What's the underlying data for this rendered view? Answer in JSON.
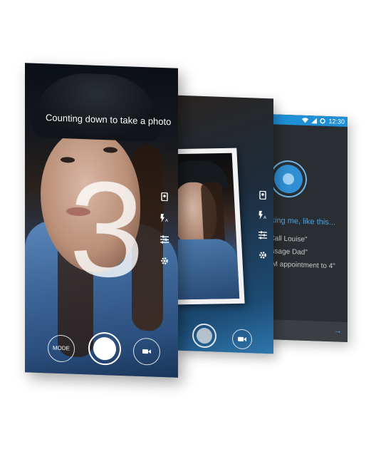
{
  "camera": {
    "prompt": "Counting down to take a photo",
    "countdown": "3",
    "mode_label": "MODE",
    "icons": [
      "portrait-icon",
      "flash-auto-icon",
      "filter-sliders-icon",
      "settings-gear-icon",
      "video-camera-icon"
    ]
  },
  "preview": {
    "icons": [
      "portrait-icon",
      "flash-auto-icon",
      "filter-sliders-icon",
      "settings-gear-icon",
      "video-camera-icon"
    ]
  },
  "assistant": {
    "status_time": "12:30",
    "prompt": "sking me, like this...",
    "suggestions": [
      "\"Call Louise\"",
      "essage Dad\"",
      "PM appointment to 4\""
    ],
    "accent_color": "#1f8fd6",
    "icons": [
      "wifi-icon",
      "cellular-signal-icon",
      "alarm-icon",
      "arrow-right-icon"
    ]
  }
}
